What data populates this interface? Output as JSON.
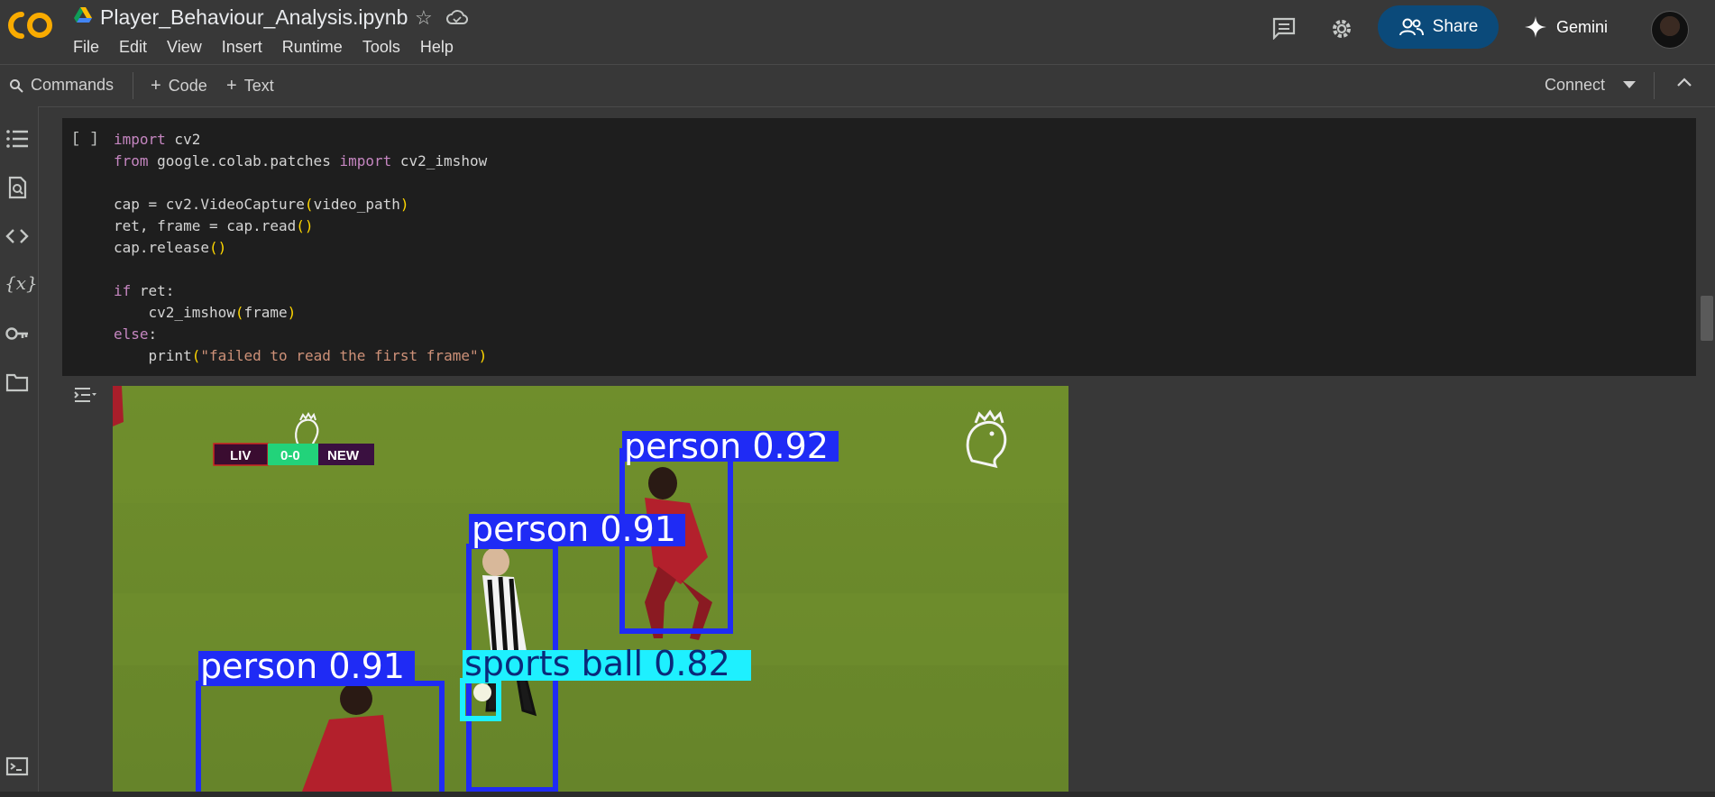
{
  "header": {
    "notebook_title": "Player_Behaviour_Analysis.ipynb",
    "logo_text": "CO",
    "menu": [
      "File",
      "Edit",
      "View",
      "Insert",
      "Runtime",
      "Tools",
      "Help"
    ],
    "share_label": "Share",
    "gemini_label": "Gemini"
  },
  "toolbar": {
    "commands_label": "Commands",
    "code_label": "Code",
    "text_label": "Text",
    "connect_label": "Connect"
  },
  "cell": {
    "run_label": "[ ]",
    "code_lines": [
      "import cv2",
      "from google.colab.patches import cv2_imshow",
      "",
      "cap = cv2.VideoCapture(video_path)",
      "ret, frame = cap.read()",
      "cap.release()",
      "",
      "if ret:",
      "    cv2_imshow(frame)",
      "else:",
      "    print(\"failed to read the first frame\")"
    ]
  },
  "output_frame": {
    "scoreboard": {
      "home": "LIV",
      "score": "0-0",
      "away": "NEW"
    },
    "detections": [
      {
        "label": "person 0.92",
        "color": "#1f2bf5"
      },
      {
        "label": "person 0.91",
        "color": "#1f2bf5"
      },
      {
        "label": "sports ball 0.82",
        "color": "#1ef0ff"
      },
      {
        "label": "person 0.91",
        "color": "#1f2bf5"
      }
    ]
  },
  "colors": {
    "page_bg": "#383838",
    "cell_bg": "#1e1e1e",
    "share_bg": "#0b4a7a",
    "keyword": "#c586c0",
    "paren": "#ffd700",
    "string": "#ce9178",
    "pitch": "#6e8a2a"
  },
  "rail_icons": [
    "table-of-contents-icon",
    "find-replace-icon",
    "code-snippets-icon",
    "variables-icon",
    "secrets-key-icon",
    "files-folder-icon",
    "terminal-icon"
  ]
}
